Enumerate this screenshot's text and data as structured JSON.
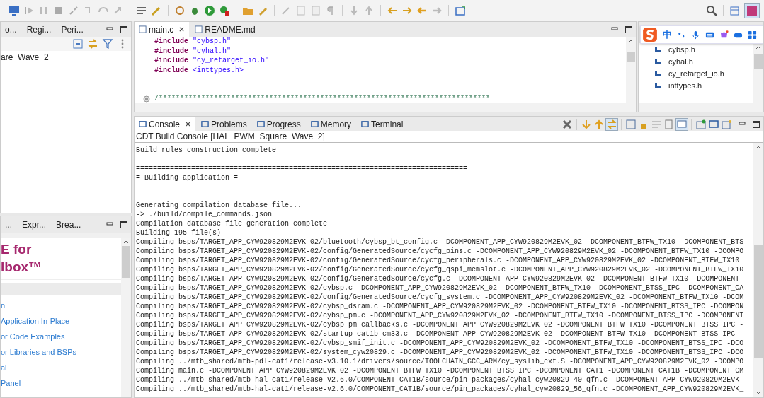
{
  "left_top": {
    "tabs": [
      {
        "label": "o...",
        "selected": false
      },
      {
        "label": "Regi...",
        "selected": false
      },
      {
        "label": "Peri...",
        "selected": false
      }
    ],
    "tree_items": [
      "are_Wave_2"
    ]
  },
  "left_bottom": {
    "tabs": [
      {
        "label": "...",
        "selected": false
      },
      {
        "label": "Expr...",
        "selected": false
      },
      {
        "label": "Brea...",
        "selected": false
      }
    ],
    "heading": [
      "E for",
      "lbox™"
    ],
    "links": [
      "n",
      "Application In-Place",
      "or Code Examples",
      "or Libraries and BSPs",
      "al",
      "Panel"
    ]
  },
  "editor": {
    "tabs": [
      {
        "label": "main.c",
        "selected": true
      },
      {
        "label": "README.md",
        "selected": false
      }
    ],
    "lines": [
      {
        "kind": "include",
        "directive": "#include",
        "arg": "\"cybsp.h\""
      },
      {
        "kind": "include",
        "directive": "#include",
        "arg": "\"cyhal.h\""
      },
      {
        "kind": "include",
        "directive": "#include",
        "arg": "\"cy_retarget_io.h\""
      },
      {
        "kind": "include",
        "directive": "#include",
        "arg": "<inttypes.h>"
      },
      {
        "kind": "blank"
      },
      {
        "kind": "blank"
      },
      {
        "kind": "comment",
        "text": "/******************************************************************************"
      }
    ]
  },
  "ime_bar": {
    "mode": "中"
  },
  "outline": {
    "items": [
      "cybsp.h",
      "cyhal.h",
      "cy_retarget_io.h",
      "inttypes.h"
    ]
  },
  "console": {
    "tabs": [
      {
        "label": "Console",
        "selected": true
      },
      {
        "label": "Problems",
        "selected": false
      },
      {
        "label": "Progress",
        "selected": false
      },
      {
        "label": "Memory",
        "selected": false
      },
      {
        "label": "Terminal",
        "selected": false
      }
    ],
    "title": "CDT Build Console [HAL_PWM_Square_Wave_2]",
    "lines": [
      "Build rules construction complete",
      {
        "kind": "blank"
      },
      "==============================================================================",
      "= Building application =",
      "==============================================================================",
      {
        "kind": "blank"
      },
      "Generating compilation database file...",
      "-> ./build/compile_commands.json",
      "Compilation database file generation complete",
      "Building 195 file(s)",
      "Compiling bsps/TARGET_APP_CYW920829M2EVK-02/bluetooth/cybsp_bt_config.c -DCOMPONENT_APP_CYW920829M2EVK_02 -DCOMPONENT_BTFW_TX10 -DCOMPONENT_BTS",
      "Compiling bsps/TARGET_APP_CYW920829M2EVK-02/config/GeneratedSource/cycfg_pins.c -DCOMPONENT_APP_CYW920829M2EVK_02 -DCOMPONENT_BTFW_TX10 -DCOMPO",
      "Compiling bsps/TARGET_APP_CYW920829M2EVK-02/config/GeneratedSource/cycfg_peripherals.c -DCOMPONENT_APP_CYW920829M2EVK_02 -DCOMPONENT_BTFW_TX10",
      "Compiling bsps/TARGET_APP_CYW920829M2EVK-02/config/GeneratedSource/cycfg_qspi_memslot.c -DCOMPONENT_APP_CYW920829M2EVK_02 -DCOMPONENT_BTFW_TX10",
      "Compiling bsps/TARGET_APP_CYW920829M2EVK-02/config/GeneratedSource/cycfg.c -DCOMPONENT_APP_CYW920829M2EVK_02 -DCOMPONENT_BTFW_TX10 -DCOMPONENT_",
      "Compiling bsps/TARGET_APP_CYW920829M2EVK-02/cybsp.c -DCOMPONENT_APP_CYW920829M2EVK_02 -DCOMPONENT_BTFW_TX10 -DCOMPONENT_BTSS_IPC -DCOMPONENT_CA",
      "Compiling bsps/TARGET_APP_CYW920829M2EVK-02/config/GeneratedSource/cycfg_system.c -DCOMPONENT_APP_CYW920829M2EVK_02 -DCOMPONENT_BTFW_TX10 -DCOM",
      "Compiling bsps/TARGET_APP_CYW920829M2EVK-02/cybsp_dsram.c -DCOMPONENT_APP_CYW920829M2EVK_02 -DCOMPONENT_BTFW_TX10 -DCOMPONENT_BTSS_IPC -DCOMPON",
      "Compiling bsps/TARGET_APP_CYW920829M2EVK-02/cybsp_pm.c -DCOMPONENT_APP_CYW920829M2EVK_02 -DCOMPONENT_BTFW_TX10 -DCOMPONENT_BTSS_IPC -DCOMPONENT",
      "Compiling bsps/TARGET_APP_CYW920829M2EVK-02/cybsp_pm_callbacks.c -DCOMPONENT_APP_CYW920829M2EVK_02 -DCOMPONENT_BTFW_TX10 -DCOMPONENT_BTSS_IPC -",
      "Compiling bsps/TARGET_APP_CYW920829M2EVK-02/startup_cat1b_cm33.c -DCOMPONENT_APP_CYW920829M2EVK_02 -DCOMPONENT_BTFW_TX10 -DCOMPONENT_BTSS_IPC -",
      "Compiling bsps/TARGET_APP_CYW920829M2EVK-02/cybsp_smif_init.c -DCOMPONENT_APP_CYW920829M2EVK_02 -DCOMPONENT_BTFW_TX10 -DCOMPONENT_BTSS_IPC -DCO",
      "Compiling bsps/TARGET_APP_CYW920829M2EVK-02/system_cyw20829.c -DCOMPONENT_APP_CYW920829M2EVK_02 -DCOMPONENT_BTFW_TX10 -DCOMPONENT_BTSS_IPC -DCO",
      "Compiling ../mtb_shared/mtb-pdl-cat1/release-v3.10.1/drivers/source/TOOLCHAIN_GCC_ARM/cy_syslib_ext.S -DCOMPONENT_APP_CYW920829M2EVK_02 -DCOMPO",
      "Compiling main.c -DCOMPONENT_APP_CYW920829M2EVK_02 -DCOMPONENT_BTFW_TX10 -DCOMPONENT_BTSS_IPC -DCOMPONENT_CAT1 -DCOMPONENT_CAT1B -DCOMPONENT_CM",
      "Compiling ../mtb_shared/mtb-hal-cat1/release-v2.6.0/COMPONENT_CAT1B/source/pin_packages/cyhal_cyw20829_40_qfn.c -DCOMPONENT_APP_CYW920829M2EVK_",
      "Compiling ../mtb_shared/mtb-hal-cat1/release-v2.6.0/COMPONENT_CAT1B/source/pin_packages/cyhal_cyw20829_56_qfn.c -DCOMPONENT_APP_CYW920829M2EVK_"
    ]
  }
}
